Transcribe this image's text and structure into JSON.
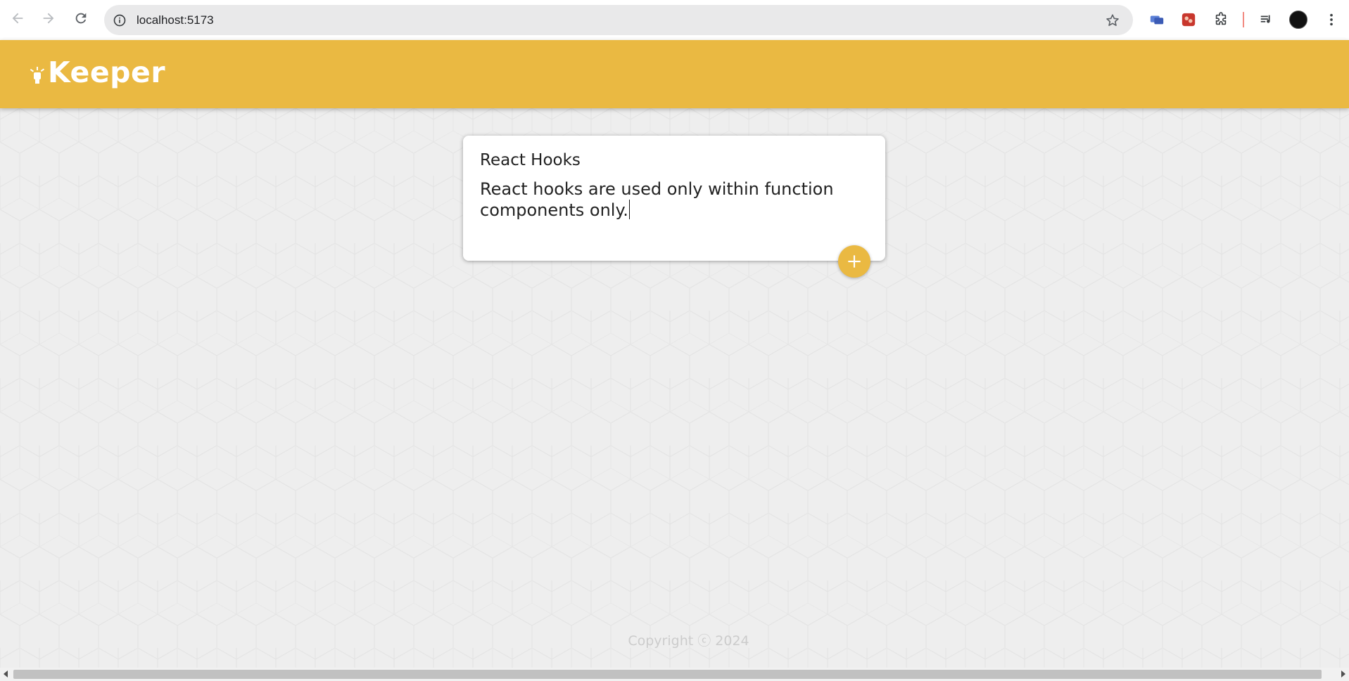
{
  "browser": {
    "url": "localhost:5173",
    "separator_color": "#f28b82"
  },
  "app": {
    "title": "Keeper",
    "header_color": "#eab942",
    "logo_icon": "lightbulb-icon"
  },
  "note_form": {
    "title_value": "React Hooks",
    "content_value": "React hooks are used only within function components only.",
    "add_button_icon": "plus-icon"
  },
  "footer": {
    "text": "Copyright ⓒ 2024"
  }
}
